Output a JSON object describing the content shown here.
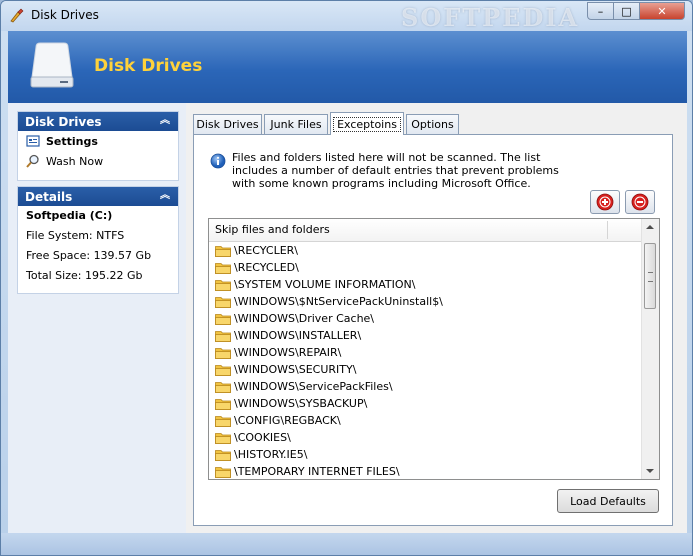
{
  "window": {
    "title": "Disk Drives",
    "watermark": "SOFTPEDIA",
    "controls": {
      "minimize": "–",
      "maximize": "□",
      "close": "✕"
    }
  },
  "banner": {
    "title": "Disk Drives"
  },
  "sidebar": {
    "actions_panel": {
      "title": "Disk Drives",
      "collapse": "︽",
      "items": [
        {
          "label": "Settings",
          "icon": "settings-icon"
        },
        {
          "label": "Wash Now",
          "icon": "magnifier-icon"
        }
      ]
    },
    "details_panel": {
      "title": "Details",
      "collapse": "︽",
      "drive_name": "Softpedia (C:)",
      "file_system": "File System: NTFS",
      "free_space": "Free Space: 139.57 Gb",
      "total_size": "Total Size: 195.22 Gb"
    }
  },
  "tabs": [
    {
      "label": "Disk Drives",
      "active": false
    },
    {
      "label": "Junk Files",
      "active": false
    },
    {
      "label": "Exceptoins",
      "active": true
    },
    {
      "label": "Options",
      "active": false
    }
  ],
  "exceptions": {
    "info": "Files and folders listed here will not be scanned. The list includes a number of default entries that prevent problems with some known programs including Microsoft Office.",
    "list_header": "Skip files and folders",
    "items": [
      "\\RECYCLER\\",
      "\\RECYCLED\\",
      "\\SYSTEM VOLUME INFORMATION\\",
      "\\WINDOWS\\$NtServicePackUninstall$\\",
      "\\WINDOWS\\Driver Cache\\",
      "\\WINDOWS\\INSTALLER\\",
      "\\WINDOWS\\REPAIR\\",
      "\\WINDOWS\\SECURITY\\",
      "\\WINDOWS\\ServicePackFiles\\",
      "\\WINDOWS\\SYSBACKUP\\",
      "\\CONFIG\\REGBACK\\",
      "\\COOKIES\\",
      "\\HISTORY.IE5\\",
      "\\TEMPORARY INTERNET FILES\\"
    ],
    "load_defaults_label": "Load Defaults",
    "colors": {
      "add": "#d8201e",
      "remove": "#d8201e",
      "folder": "#f1c340"
    }
  }
}
